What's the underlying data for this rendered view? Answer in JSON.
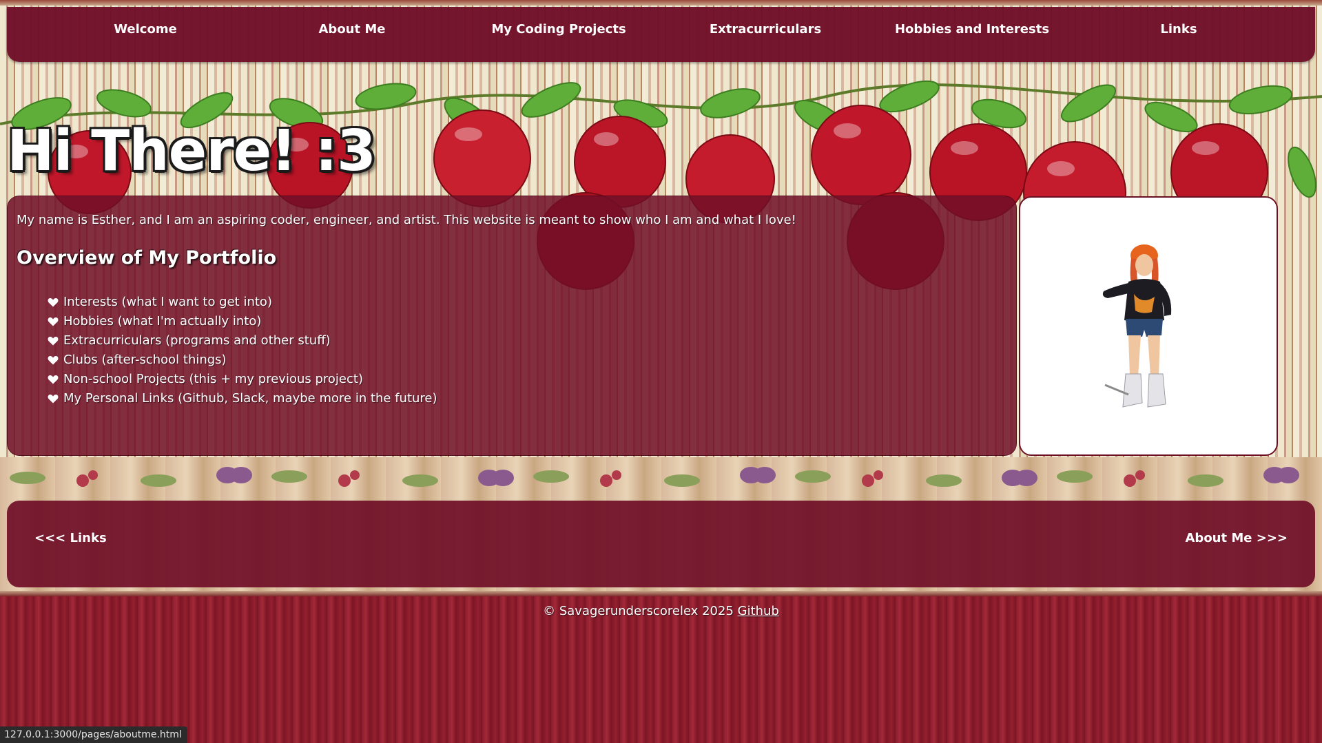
{
  "nav": {
    "items": [
      {
        "label": "Welcome"
      },
      {
        "label": "About Me"
      },
      {
        "label": "My Coding Projects"
      },
      {
        "label": "Extracurriculars"
      },
      {
        "label": "Hobbies and Interests"
      },
      {
        "label": "Links"
      }
    ]
  },
  "hero": {
    "title": "Hi There! :3"
  },
  "intro": {
    "text": "My name is Esther, and I am an aspiring coder, engineer, and artist. This website is meant to show who I am and what I love!"
  },
  "overview": {
    "heading": "Overview of My Portfolio",
    "items": [
      "Interests (what I want to get into)",
      "Hobbies (what I'm actually into)",
      "Extracurriculars (programs and other stuff)",
      "Clubs (after-school things)",
      "Non-school Projects (this + my previous project)",
      "My Personal Links (Github, Slack, maybe more in the future)"
    ]
  },
  "pager": {
    "prev_label": "<<< Links",
    "next_label": "About Me >>>"
  },
  "footer": {
    "copyright": "© Savagerunderscorelex 2025",
    "github_label": "Github"
  },
  "status_bar": {
    "url": "127.0.0.1:3000/pages/aboutme.html"
  },
  "colors": {
    "panel": "#700f28",
    "accent_text": "#ffffff",
    "wallpaper_cream": "#efe8cf",
    "apple_red": "#c0182a",
    "leaf_green": "#4f9a32"
  },
  "icons": {
    "list_bullet": "heart-icon"
  }
}
